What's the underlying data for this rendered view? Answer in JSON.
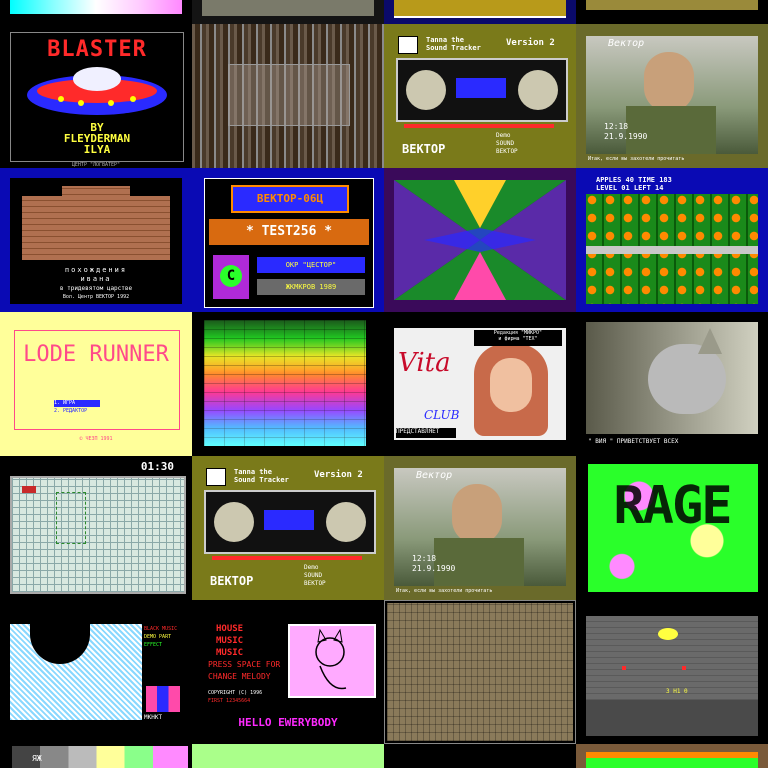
{
  "gallery": {
    "tiles": [
      {
        "name": "blaster",
        "title": "BLASTER",
        "by": "BY",
        "author1": "FLEYDERMAN",
        "author2": "ILYA",
        "credit": "ЦЕНТР \"ЛОГВАТЕР\""
      },
      {
        "name": "board-photo-1"
      },
      {
        "name": "sound-tracker-1",
        "title1": "Tanna the",
        "title2": "Sound Tracker",
        "version": "Version 2",
        "footer1": "Demo",
        "footer2": "SOUND",
        "footer3": "ВЕКТОР",
        "brand": "ВЕКТОР"
      },
      {
        "name": "vektor-photo-1",
        "logo": "Вектор",
        "time": "12:18",
        "date": "21.9.1990",
        "caption": "Итак, если вы захотели прочитать"
      },
      {
        "name": "castle",
        "line1": "похождения",
        "line2": "ивана",
        "line3": "в тридевятом царстве",
        "line4": "Вол. Центр ВЕКТОР 1992"
      },
      {
        "name": "vektor-test",
        "title": "ВЕКТОР-06Ц",
        "test": "* TEST256 *",
        "badge1": "ОКР \"ЦЕСТОР\"",
        "badge2": "ЖКМКРОВ 1989",
        "logo": "C"
      },
      {
        "name": "geometric-pattern"
      },
      {
        "name": "apples-game",
        "hud1": "APPLES  40   TIME 183",
        "hud2": "LEVEL  01   LEFT  14"
      },
      {
        "name": "lode-runner",
        "title": "LODE RUNNER",
        "menu1": "1. ИГРА",
        "menu2": "2. РЕДАКТОР",
        "footer": "© ЧЕЗП 1991"
      },
      {
        "name": "color-palette"
      },
      {
        "name": "vita-club",
        "header1": "Редакция \"МИКРО\"",
        "header2": "и фирма \"ТЕХ\"",
        "brand": "Vita",
        "club": "CLUB",
        "caption": "ПРЕДСТАВЛЯЕТ"
      },
      {
        "name": "kitten",
        "caption": "\" ВИЯ \" ПРИВЕТСТВУЕТ ВСЕХ"
      },
      {
        "name": "minesweeper",
        "time": "01:30"
      },
      {
        "name": "sound-tracker-2",
        "title1": "Tanna the",
        "title2": "Sound Tracker",
        "version": "Version 2",
        "footer1": "Demo",
        "footer2": "SOUND",
        "footer3": "ВЕКТОР",
        "brand": "ВЕКТОР"
      },
      {
        "name": "vektor-photo-2",
        "logo": "Вектор",
        "time": "12:18",
        "date": "21.9.1990",
        "caption": "Итак, если вы захотели прочитать"
      },
      {
        "name": "rage",
        "title": "RAGE"
      },
      {
        "name": "portrait-demo",
        "line1": "BLACK MUSIC",
        "line2": "DEMO PART",
        "line3": "EFFECT",
        "mark": "MKHKT"
      },
      {
        "name": "hello-everybody",
        "line1": "HOUSE",
        "line2": "MUSIC",
        "line3": "MUSIC",
        "line4": "PRESS SPACE FOR",
        "line5": "CHANGE MELODY",
        "line6": "COPYRIGHT (C) 1996",
        "line7": "FIRST 12345664",
        "footer": "HELLO EWERYBODY"
      },
      {
        "name": "board-photo-2"
      },
      {
        "name": "space-shooter",
        "hud": "3  H1  0"
      },
      {
        "name": "partial-bars",
        "label": "ЯЖ"
      },
      {
        "name": "partial-green"
      },
      {
        "name": "partial-black"
      },
      {
        "name": "partial-logo"
      }
    ]
  }
}
